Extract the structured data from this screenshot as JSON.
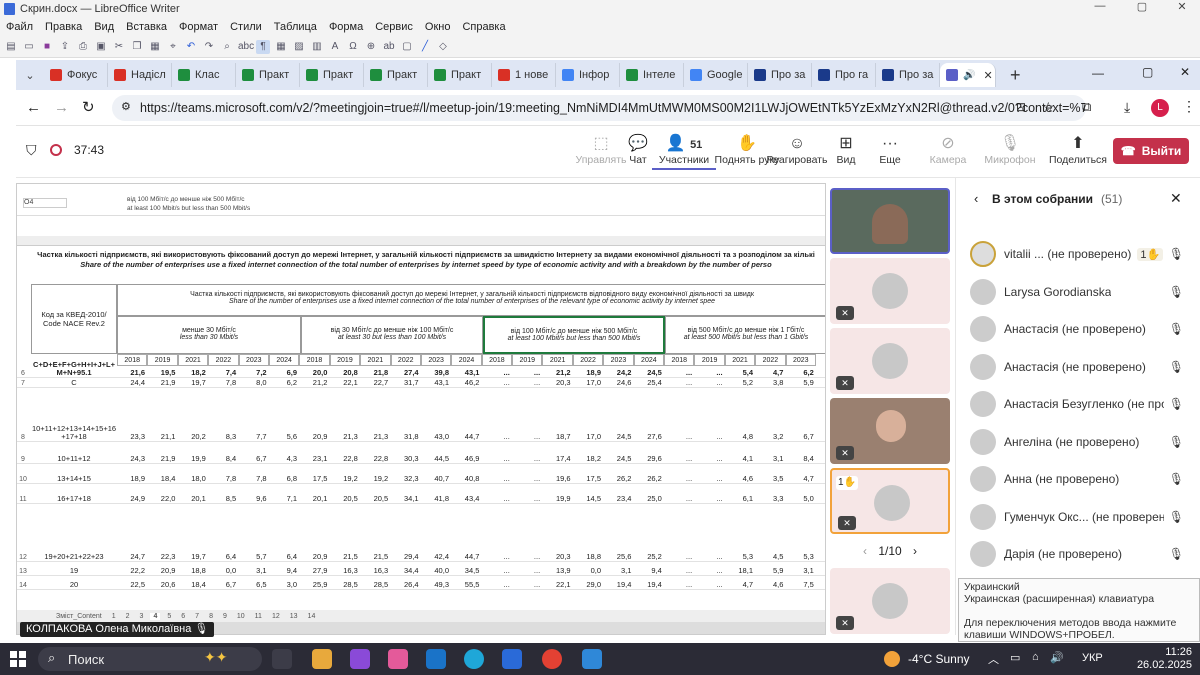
{
  "libreoffice": {
    "title": "Скрин.docx — LibreOffice Writer",
    "menu": [
      "Файл",
      "Правка",
      "Вид",
      "Вставка",
      "Формат",
      "Стили",
      "Таблица",
      "Форма",
      "Сервис",
      "Окно",
      "Справка"
    ]
  },
  "browser": {
    "tabs": [
      {
        "label": "Фокус",
        "color": "#d93025"
      },
      {
        "label": "Надісл",
        "color": "#d93025"
      },
      {
        "label": "Клас",
        "color": "#1e8e3e"
      },
      {
        "label": "Практ",
        "color": "#1e8e3e"
      },
      {
        "label": "Практ",
        "color": "#1e8e3e"
      },
      {
        "label": "Практ",
        "color": "#1e8e3e"
      },
      {
        "label": "Практ",
        "color": "#1e8e3e"
      },
      {
        "label": "1 нове",
        "color": "#d93025"
      },
      {
        "label": "Інфор",
        "color": "#4285f4"
      },
      {
        "label": "Інтеле",
        "color": "#1e8e3e"
      },
      {
        "label": "Google",
        "color": "#4285f4"
      },
      {
        "label": "Про за",
        "color": "#1a3a8a"
      },
      {
        "label": "Про га",
        "color": "#1a3a8a"
      },
      {
        "label": "Про за",
        "color": "#1a3a8a"
      },
      {
        "label": "",
        "color": "#5b5fc7",
        "active": true
      }
    ],
    "url": "https://teams.microsoft.com/v2/?meetingjoin=true#/l/meetup-join/19:meeting_NmNiMDI4MmUtMWM0MS00M2I1LWJjOWEtNTk5YzExMzYxN2Rl@thread.v2/0?context=%7b\"Tid\"...",
    "profile_initial": "L"
  },
  "meeting": {
    "timer": "37:43",
    "participants_count": "51",
    "buttons": {
      "share": "Управлять",
      "chat": "Чат",
      "people": "Участники",
      "raise": "Поднять руку",
      "react": "Реагировать",
      "view": "Вид",
      "more": "Еще",
      "camera": "Камера",
      "mic": "Микрофон",
      "share_screen": "Поделиться",
      "leave": "Выйти"
    },
    "pager": "1/10",
    "presenter": "КОЛПАКОВА Олена Миколаївна",
    "raised_tile": "1"
  },
  "panel": {
    "title": "В этом собрании",
    "count": "(51)",
    "people": [
      {
        "name": "vitalii ...  (не проверено)",
        "badge": "1"
      },
      {
        "name": "Larysa Gorodianska"
      },
      {
        "name": "Анастасія (не проверено)"
      },
      {
        "name": "Анастасія (не проверено)"
      },
      {
        "name": "Анастасія Безугленко (не про..."
      },
      {
        "name": "Ангеліна (не проверено)"
      },
      {
        "name": "Анна (не проверено)"
      },
      {
        "name": "Гуменчук Окс... (не проверено)"
      },
      {
        "name": "Дарія (не проверено)"
      }
    ]
  },
  "ime": {
    "line1": "Украинский",
    "line2": "Украинская (расширенная) клавиатура",
    "line3": "Для переключения методов ввода нажмите клавиши WINDOWS+ПРОБЕЛ."
  },
  "sheet": {
    "cell_ref": "O4",
    "formula1": "від 100 Мбіт/с до менше ніж 500 Мбіт/с",
    "formula2": "at least 100 Mbit/s but less than 500 Mbit/s",
    "title_ua": "Частка кількості підприємств, які використовують фіксований доступ до мережі Інтернет, у загальній кількості підприємств за швидкістю Інтернету за видами економічної діяльності та з розподілом за кількі",
    "title_en": "Share of the number of enterprises use a fixed internet connection of the total number of enterprises by internet speed  by type of economic activity and with a breakdown by the number of perso",
    "sub_ua": "Частка кількості підприємств, які використовують фіксований доступ до мережі Інтернет, у загальній кількості підприємств відповідного виду економічної діяльності за швидк",
    "sub_en": "Share of the number of enterprises use a fixed internet connection of the total number of enterprises of the relevant type of economic activity by internet spee",
    "kved": "Код за КВЕД-2010/ Code NACE Rev.2",
    "groups": [
      {
        "ua": "менше 30 Мбіт/с",
        "en": "less than 30 Mbit/s"
      },
      {
        "ua": "від 30 Мбіт/с до менше ніж 100 Мбіт/с",
        "en": "at least 30 but less than 100 Mbit/s"
      },
      {
        "ua": "від 100 Мбіт/с до менше ніж 500 Мбіт/с",
        "en": "at least 100 Mbit/s but less than 500 Mbit/s"
      },
      {
        "ua": "від 500 Мбіт/с до менше ніж 1 Гбіт/с",
        "en": "at least 500 Mbit/s but less than 1 Gbit/s"
      }
    ],
    "years": [
      "2018",
      "2019",
      "2021",
      "2022",
      "2023",
      "2024",
      "2018",
      "2019",
      "2021",
      "2022",
      "2023",
      "2024",
      "2018",
      "2019",
      "2021",
      "2022",
      "2023",
      "2024",
      "2018",
      "2019",
      "2021",
      "2022",
      "2023"
    ],
    "rows": [
      {
        "n": "6",
        "code": "C+D+E+F+G+H+I+J+L+M+N+95.1",
        "v": [
          "21,6",
          "19,5",
          "18,2",
          "7,4",
          "7,2",
          "6,9",
          "20,0",
          "20,8",
          "21,8",
          "27,4",
          "39,8",
          "43,1",
          "...",
          "...",
          "21,2",
          "18,9",
          "24,2",
          "24,5",
          "...",
          "...",
          "5,4",
          "4,7",
          "6,2"
        ]
      },
      {
        "n": "7",
        "code": "C",
        "v": [
          "24,4",
          "21,9",
          "19,7",
          "7,8",
          "8,0",
          "6,2",
          "21,2",
          "22,1",
          "22,7",
          "31,7",
          "43,1",
          "46,2",
          "...",
          "...",
          "20,3",
          "17,0",
          "24,6",
          "25,4",
          "...",
          "...",
          "5,2",
          "3,8",
          "5,9"
        ]
      },
      {
        "n": "8",
        "code": "10+11+12+13+14+15+16+17+18",
        "v": [
          "23,3",
          "21,1",
          "20,2",
          "8,3",
          "7,7",
          "5,6",
          "20,9",
          "21,3",
          "21,3",
          "31,8",
          "43,0",
          "44,7",
          "...",
          "...",
          "18,7",
          "17,0",
          "24,5",
          "27,6",
          "...",
          "...",
          "4,8",
          "3,2",
          "6,7"
        ]
      },
      {
        "n": "9",
        "code": "10+11+12",
        "v": [
          "24,3",
          "21,9",
          "19,9",
          "8,4",
          "6,7",
          "4,3",
          "23,1",
          "22,8",
          "22,8",
          "30,3",
          "44,5",
          "46,9",
          "...",
          "...",
          "17,4",
          "18,2",
          "24,5",
          "29,6",
          "...",
          "...",
          "4,1",
          "3,1",
          "8,4"
        ]
      },
      {
        "n": "10",
        "code": "13+14+15",
        "v": [
          "18,9",
          "18,4",
          "18,0",
          "7,8",
          "7,8",
          "6,8",
          "17,5",
          "19,2",
          "19,2",
          "32,3",
          "40,7",
          "40,8",
          "...",
          "...",
          "19,6",
          "17,5",
          "26,2",
          "26,2",
          "...",
          "...",
          "4,6",
          "3,5",
          "4,7"
        ]
      },
      {
        "n": "11",
        "code": "16+17+18",
        "v": [
          "24,9",
          "22,0",
          "20,1",
          "8,5",
          "9,6",
          "7,1",
          "20,1",
          "20,5",
          "20,5",
          "34,1",
          "41,8",
          "43,4",
          "...",
          "...",
          "19,9",
          "14,5",
          "23,4",
          "25,0",
          "...",
          "...",
          "6,1",
          "3,3",
          "5,0"
        ]
      },
      {
        "n": "12",
        "code": "19+20+21+22+23",
        "v": [
          "24,7",
          "22,3",
          "19,7",
          "6,4",
          "5,7",
          "6,4",
          "20,9",
          "21,5",
          "21,5",
          "29,4",
          "42,4",
          "44,7",
          "...",
          "...",
          "20,3",
          "18,8",
          "25,6",
          "25,2",
          "...",
          "...",
          "5,3",
          "4,5",
          "5,3"
        ]
      },
      {
        "n": "13",
        "code": "19",
        "v": [
          "22,2",
          "20,9",
          "18,8",
          "0,0",
          "3,1",
          "9,4",
          "27,9",
          "16,3",
          "16,3",
          "34,4",
          "40,0",
          "34,5",
          "...",
          "...",
          "13,9",
          "0,0",
          "3,1",
          "9,4",
          "...",
          "...",
          "18,1",
          "5,9",
          "3,1"
        ]
      },
      {
        "n": "14",
        "code": "20",
        "v": [
          "22,5",
          "20,6",
          "18,4",
          "6,7",
          "6,5",
          "3,0",
          "25,9",
          "28,5",
          "28,5",
          "26,4",
          "49,3",
          "55,5",
          "...",
          "...",
          "22,1",
          "29,0",
          "19,4",
          "19,4",
          "...",
          "...",
          "4,7",
          "4,6",
          "7,5"
        ]
      }
    ],
    "sheet_tabs": [
      "Зміст_Content",
      "1",
      "2",
      "3",
      "4",
      "5",
      "6",
      "7",
      "8",
      "9",
      "10",
      "11",
      "12",
      "13",
      "14"
    ]
  },
  "taskbar": {
    "search": "Поиск",
    "weather": "-4°C  Sunny",
    "lang": "УКР",
    "time": "11:26",
    "date": "26.02.2025"
  }
}
